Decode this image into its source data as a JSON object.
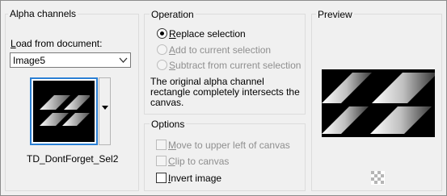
{
  "alpha_channels": {
    "title": "Alpha channels",
    "load_from_label": "Load from document:",
    "document_selected": "Image5",
    "selection_name": "TD_DontForget_Sel2",
    "icons": {
      "dropdown": "chevron-down-icon",
      "thumbnail_menu": "triangle-down-icon"
    }
  },
  "operation": {
    "title": "Operation",
    "options": [
      {
        "label": "Replace selection",
        "selected": true,
        "enabled": true
      },
      {
        "label": "Add to current selection",
        "selected": false,
        "enabled": false
      },
      {
        "label": "Subtract from current selection",
        "selected": false,
        "enabled": false
      }
    ],
    "description": "The original alpha channel rectangle completely intersects the canvas."
  },
  "options": {
    "title": "Options",
    "items": [
      {
        "label": "Move to upper left of canvas",
        "checked": false,
        "enabled": false
      },
      {
        "label": "Clip to canvas",
        "checked": false,
        "enabled": false
      },
      {
        "label": "Invert image",
        "checked": false,
        "enabled": true
      }
    ]
  },
  "preview": {
    "title": "Preview",
    "icons": {
      "transparency": "checkerboard-icon"
    }
  },
  "colors": {
    "selection_border": "#2a7fd4",
    "disabled_text": "#8f8f8f"
  }
}
